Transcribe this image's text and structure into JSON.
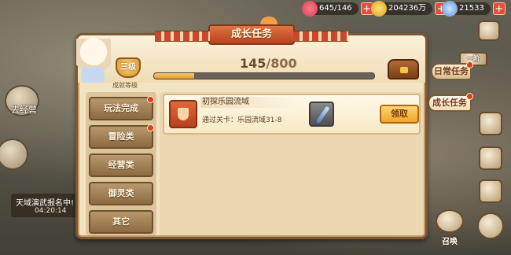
{
  "resources": {
    "stamina": "645/146",
    "gold": "204236万",
    "gems": "21533"
  },
  "left_overlay": {
    "location_label": "去经营",
    "event_title": "天域演武报名中!",
    "event_timer": "04:20:14"
  },
  "right_menu": {
    "daily_tasks": "日常任务",
    "growth_tasks": "成长任务",
    "summon": "召唤",
    "badge_label": "一阶"
  },
  "panel": {
    "title": "成长任务",
    "level_badge": "三级",
    "level_label": "成就等级",
    "progress_current": "145",
    "progress_separator": "/",
    "progress_total": "800",
    "progress_value": 145,
    "progress_max": 800
  },
  "categories": [
    {
      "label": "玩法完成",
      "has_dot": true
    },
    {
      "label": "冒险类",
      "has_dot": true
    },
    {
      "label": "经营类",
      "has_dot": false
    },
    {
      "label": "御灵类",
      "has_dot": false
    },
    {
      "label": "其它",
      "has_dot": false
    }
  ],
  "tasks": [
    {
      "title": "初探乐园流域",
      "description": "通过关卡：乐园流域31-8",
      "claim_label": "领取"
    }
  ],
  "colors": {
    "accent_orange": "#e0743f",
    "panel_bg": "#f2e3c2",
    "claim_button": "#f1a42a",
    "plus_button": "#e0503a"
  }
}
